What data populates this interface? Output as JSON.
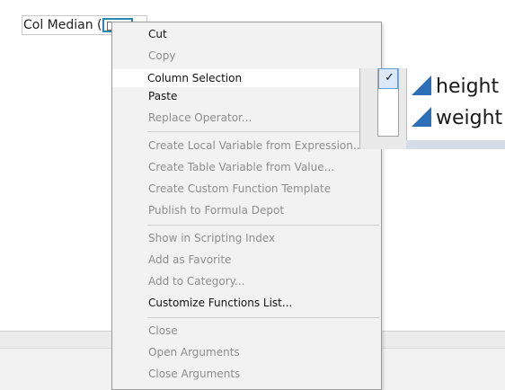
{
  "formula": {
    "text": "Col Median ("
  },
  "menu": {
    "items": [
      {
        "label": "Cut",
        "disabled": false
      },
      {
        "label": "Copy",
        "disabled": true
      },
      {
        "label": "Column Selection",
        "disabled": false
      },
      {
        "label": "Paste",
        "disabled": false
      },
      {
        "label": "Replace Operator...",
        "disabled": true
      },
      {
        "label": "Create Local Variable from Expression...",
        "disabled": true
      },
      {
        "label": "Create Table Variable from Value...",
        "disabled": true
      },
      {
        "label": "Create Custom Function Template",
        "disabled": true
      },
      {
        "label": "Publish to Formula Depot",
        "disabled": true
      },
      {
        "label": "Show in Scripting Index",
        "disabled": true
      },
      {
        "label": "Add as Favorite",
        "disabled": true
      },
      {
        "label": "Add to Category...",
        "disabled": true
      },
      {
        "label": "Customize Functions List...",
        "disabled": false
      },
      {
        "label": "Close",
        "disabled": true
      },
      {
        "label": "Open Arguments",
        "disabled": true
      },
      {
        "label": "Close Arguments",
        "disabled": true
      }
    ]
  },
  "submenu": {
    "check": "✓",
    "columns": [
      {
        "name": "height",
        "icon": "continuous-column-icon"
      },
      {
        "name": "weight",
        "icon": "continuous-column-icon"
      }
    ]
  },
  "colors": {
    "accent": "#2a86b6",
    "column_icon": "#2c6fb9",
    "highlight": "#ffffff",
    "disabled_text": "#8d8d8d"
  }
}
